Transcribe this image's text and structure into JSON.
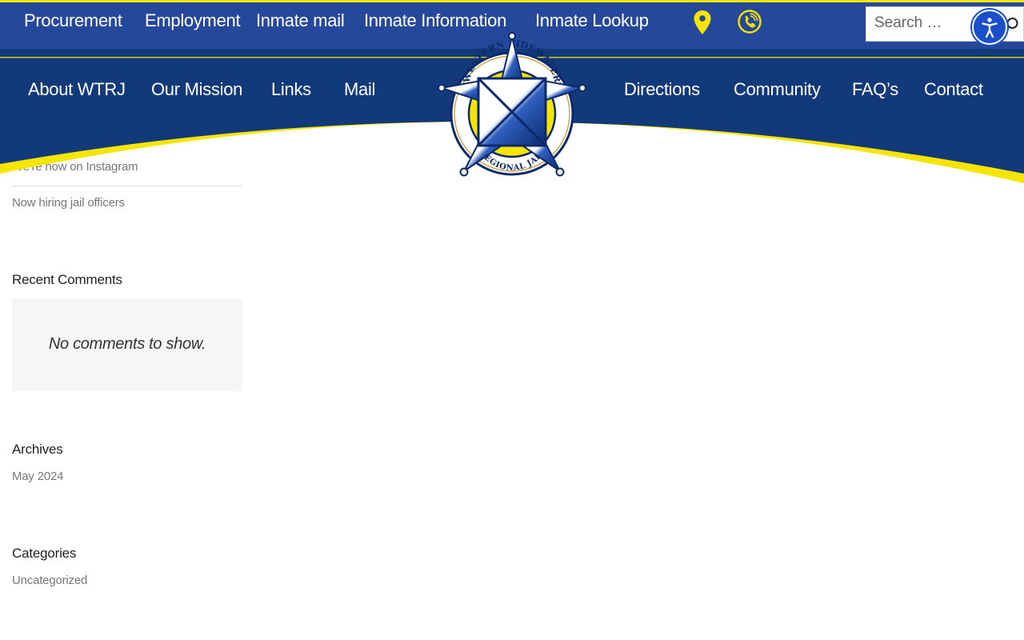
{
  "top_nav": {
    "links": [
      "Procurement",
      "Employment",
      "Inmate mail",
      "Inmate Information",
      "Inmate Lookup"
    ],
    "icons": [
      "location-pin-icon",
      "phone-icon"
    ]
  },
  "search": {
    "placeholder": "Search …"
  },
  "main_nav": {
    "left": [
      "About WTRJ",
      "Our Mission",
      "Links",
      "Mail"
    ],
    "right": [
      "Directions",
      "Community",
      "FAQ’s",
      "Contact"
    ]
  },
  "logo": {
    "top_text": "WESTERN TIDEWATER",
    "bottom_text": "REGIONAL JAIL"
  },
  "sidebar": {
    "recent_posts": [
      "We're now on Instagram",
      "Now hiring jail officers"
    ],
    "recent_comments": {
      "title": "Recent Comments",
      "empty_text": "No comments to show."
    },
    "archives": {
      "title": "Archives",
      "items": [
        "May 2024"
      ]
    },
    "categories": {
      "title": "Categories",
      "items": [
        "Uncategorized"
      ]
    }
  },
  "colors": {
    "brand_blue": "#26489a",
    "nav_blue": "#12397a",
    "accent_yellow": "#f5e500"
  }
}
